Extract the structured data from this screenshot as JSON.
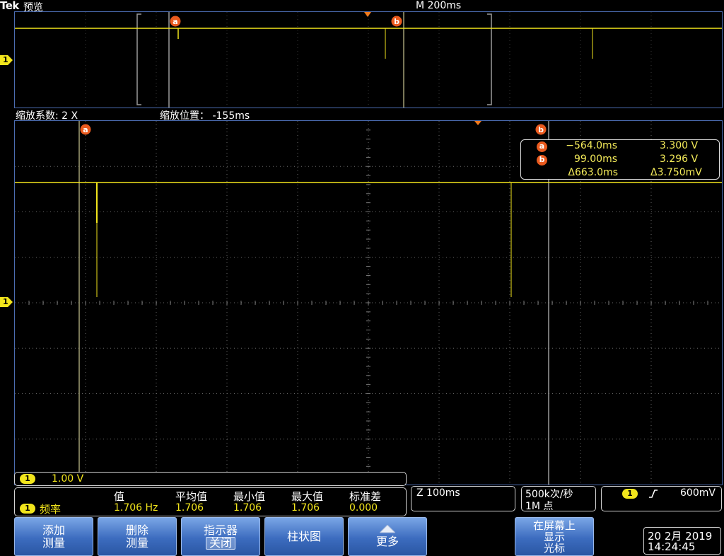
{
  "header": {
    "brand": "Tek",
    "mode": "预览",
    "timebase": "M 200ms"
  },
  "overview": {
    "cursor_a": "a",
    "cursor_b": "b",
    "channel_marker": "1"
  },
  "zoom_info": {
    "factor": "缩放系数: 2 X",
    "position": "缩放位置： -155ms"
  },
  "main": {
    "cursor_a": "a",
    "cursor_b": "b",
    "channel_marker": "1"
  },
  "cursor_readout": {
    "a": {
      "label": "a",
      "time": "−564.0ms",
      "volts": "3.300 V"
    },
    "b": {
      "label": "b",
      "time": "99.00ms",
      "volts": "3.296 V"
    },
    "delta": {
      "time": "Δ663.0ms",
      "volts": "Δ3.750mV"
    }
  },
  "channel_label": {
    "channel": "1",
    "scale": "1.00 V"
  },
  "measurements": {
    "headers": [
      "值",
      "平均值",
      "最小值",
      "最大值",
      "标准差"
    ],
    "rows": [
      {
        "channel": "1",
        "name": "频率",
        "value": "1.706 Hz",
        "mean": "1.706",
        "min": "1.706",
        "max": "1.706",
        "std_dev": "0.000"
      }
    ]
  },
  "zoom_timebase": "Z 100ms",
  "acquisition": {
    "sample_rate": "500k次/秒",
    "record_length": "1M 点"
  },
  "trigger": {
    "channel": "1",
    "slope_icon": "rising-edge-icon",
    "level": "600mV"
  },
  "menu": [
    {
      "lines": [
        "添加",
        "测量"
      ]
    },
    {
      "lines": [
        "删除",
        "测量"
      ]
    },
    {
      "lines": [
        "指示器",
        "关闭"
      ]
    },
    {
      "lines": [
        "柱状图"
      ]
    },
    {
      "lines": [
        "更多"
      ],
      "icon": "up-arrow-icon"
    },
    {
      "lines": [
        "在屏幕上",
        "显示",
        "光标"
      ]
    }
  ],
  "clock": {
    "date": "20 2月 2019",
    "time": "14:24:45"
  },
  "colors": {
    "channel_1": "#f2e51c",
    "cursor_marker": "#ea5a1e",
    "graticule_border": "#4b6cb0",
    "menu_button": "#3c6cbf"
  }
}
